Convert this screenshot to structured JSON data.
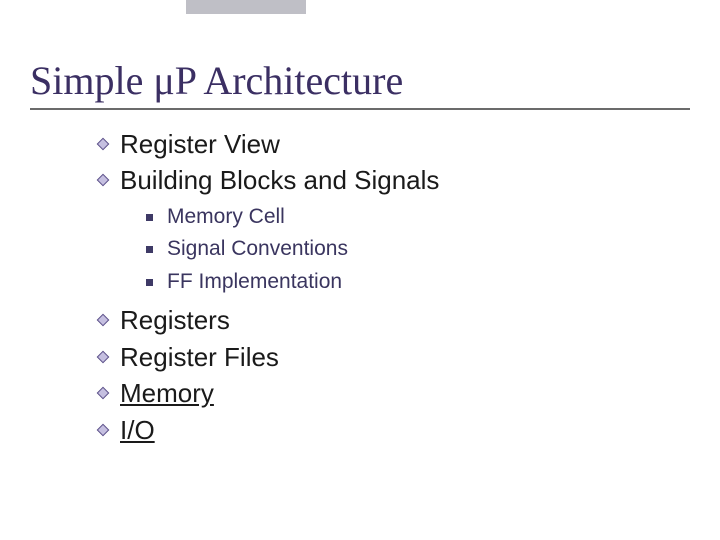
{
  "title": "Simple μP Architecture",
  "colors": {
    "title": "#3b2f63",
    "accent_bar": "#bfbfc6",
    "bullet_fill": "#c5bfe0",
    "bullet_stroke": "#5a4e88",
    "sub_bullet": "#3e3a66",
    "sub_text": "#3a355f"
  },
  "bullets": [
    {
      "label": "Register View",
      "underline": false
    },
    {
      "label": "Building Blocks and Signals",
      "underline": false,
      "sub": [
        {
          "label": "Memory Cell"
        },
        {
          "label": "Signal Conventions"
        },
        {
          "label": "FF Implementation"
        }
      ]
    },
    {
      "label": "Registers",
      "underline": false
    },
    {
      "label": "Register Files",
      "underline": false
    },
    {
      "label": "Memory",
      "underline": true
    },
    {
      "label": "I/O",
      "underline": true
    }
  ]
}
